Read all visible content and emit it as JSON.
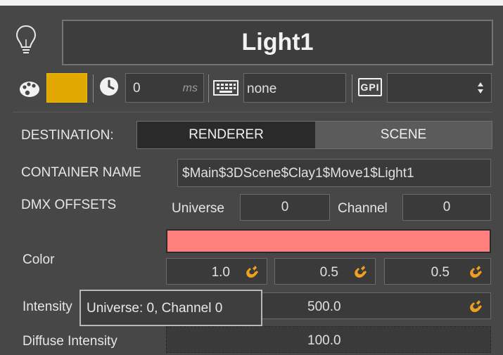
{
  "header": {
    "title": "Light1"
  },
  "toolbar": {
    "color_swatch": "#e0a800",
    "delay_value": "0",
    "delay_unit": "ms",
    "keyboard_value": "none",
    "gpi_label": "GPI",
    "gpi_select": ""
  },
  "destination": {
    "label": "DESTINATION:",
    "options": [
      "RENDERER",
      "SCENE"
    ],
    "selected": "RENDERER"
  },
  "container": {
    "label": "CONTAINER NAME",
    "value": "$Main$3DScene$Clay1$Move1$Light1"
  },
  "dmx": {
    "label": "DMX OFFSETS",
    "universe_label": "Universe",
    "universe_value": "0",
    "channel_label": "Channel",
    "channel_value": "0"
  },
  "color": {
    "label": "Color",
    "swatch": "#ff7f7f",
    "r": "1.0",
    "g": "0.5",
    "b": "0.5"
  },
  "intensity": {
    "label": "Intensity",
    "value": "500.0"
  },
  "diffuse": {
    "label": "Diffuse Intensity",
    "value": "100.0"
  },
  "tooltip": {
    "text": "Universe: 0, Channel 0"
  },
  "colors": {
    "accent": "#f0a020",
    "panel": "#474747",
    "field": "#3a3a3a"
  }
}
